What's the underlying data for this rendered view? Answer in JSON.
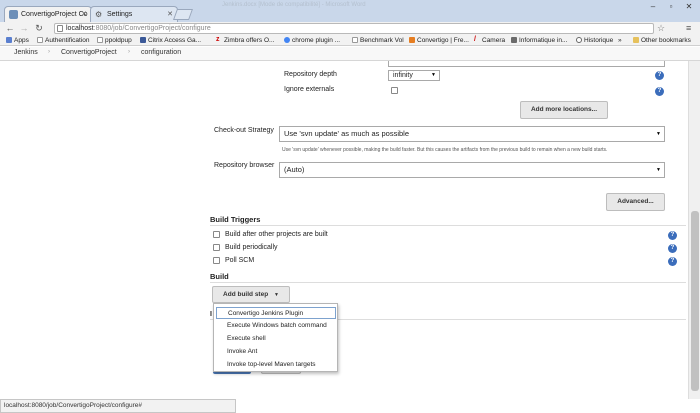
{
  "browser": {
    "tabs": [
      {
        "title": "ConvertigoProject Co",
        "active": true
      },
      {
        "title": "Settings",
        "active": false
      }
    ],
    "faded_window_title": "Jenkins.docx [Mode de compatibilité] - Microsoft Word",
    "url_host": "localhost",
    "url_path": ":8080/job/ConvertigoProject/configure",
    "bookmarks": [
      {
        "label": "Apps",
        "icon": "apps-icon"
      },
      {
        "label": "Authentification",
        "icon": "page-icon"
      },
      {
        "label": "ppoldpup",
        "icon": "page-icon"
      },
      {
        "label": "Citrix Access Ga...",
        "icon": "citrix-icon"
      },
      {
        "label": "Zimbra offers O...",
        "icon": "zimbra-icon"
      },
      {
        "label": "chrome plugin ...",
        "icon": "google-icon"
      },
      {
        "label": "Benchmark Vol",
        "icon": "page-icon"
      },
      {
        "label": "Convertigo | Fre...",
        "icon": "convertigo-icon"
      },
      {
        "label": "Camera",
        "icon": "camera-icon"
      },
      {
        "label": "Informatique in...",
        "icon": "page-icon"
      },
      {
        "label": "Historique",
        "icon": "clock-icon"
      }
    ],
    "bookmarks_overflow": "»",
    "other_bookmarks": "Other bookmarks"
  },
  "breadcrumb": [
    "Jenkins",
    "ConvertigoProject",
    "configuration"
  ],
  "scm": {
    "repository_depth_label": "Repository depth",
    "repository_depth_value": "infinity",
    "ignore_externals_label": "Ignore externals",
    "add_more_locations": "Add more locations...",
    "checkout_strategy_label": "Check-out Strategy",
    "checkout_strategy_value": "Use 'svn update' as much as possible",
    "checkout_strategy_hint": "Use 'svn update' whenever possible, making the build faster. But this causes the artifacts from the previous build to remain when a new build starts.",
    "repository_browser_label": "Repository browser",
    "repository_browser_value": "(Auto)",
    "advanced_button": "Advanced..."
  },
  "build_triggers": {
    "title": "Build Triggers",
    "options": [
      {
        "label": "Build after other projects are built",
        "checked": false
      },
      {
        "label": "Build periodically",
        "checked": false
      },
      {
        "label": "Poll SCM",
        "checked": false
      }
    ]
  },
  "build": {
    "title": "Build",
    "add_build_step": "Add build step",
    "menu_items": [
      "Convertigo Jenkins Plugin",
      "Execute Windows batch command",
      "Execute shell",
      "Invoke Ant",
      "Invoke top-level Maven targets"
    ],
    "selected_index": 0
  },
  "status_bar": "localhost:8080/job/ConvertigoProject/configure#",
  "colors": {
    "help_icon": "#3b6dbb",
    "tab_strip": "#c9d7ea",
    "selected_menu_border": "#7da2ce"
  }
}
